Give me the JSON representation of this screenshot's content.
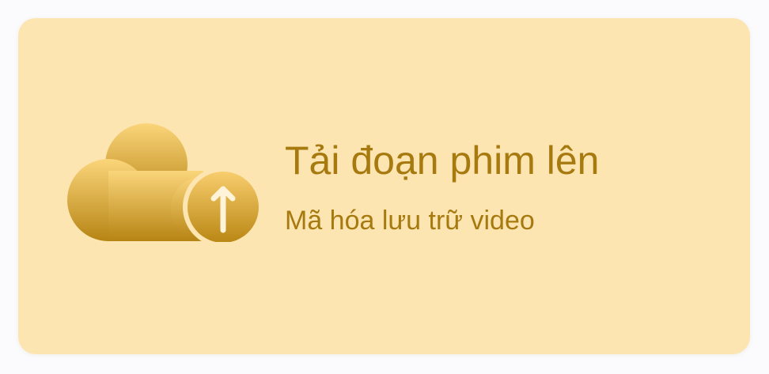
{
  "upload_card": {
    "icon": "cloud-upload-icon",
    "title": "Tải đoạn phim lên",
    "subtitle": "Mã hóa lưu trữ video"
  },
  "colors": {
    "card_background": "#fde5b2",
    "text": "#a77a0f",
    "icon_gradient_top": "#fbd57a",
    "icon_gradient_bottom": "#b68414"
  }
}
